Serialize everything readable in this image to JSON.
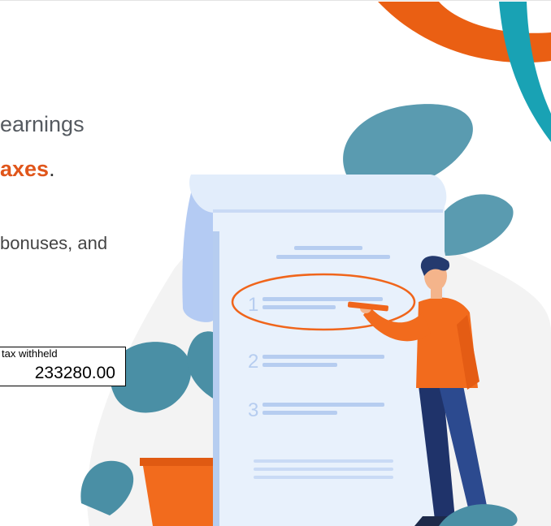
{
  "hero": {
    "line1": "earnings",
    "line2_accent": "axes",
    "line2_tail": ".",
    "line3": "bonuses, and"
  },
  "tax_field": {
    "label": "tax withheld",
    "value": "233280.00"
  },
  "illustration": {
    "list_numbers": [
      "1",
      "2",
      "3"
    ],
    "colors": {
      "orange": "#f0651b",
      "teal": "#4a94a8",
      "paper": "#e8f1fc",
      "navy": "#243a6e"
    }
  }
}
